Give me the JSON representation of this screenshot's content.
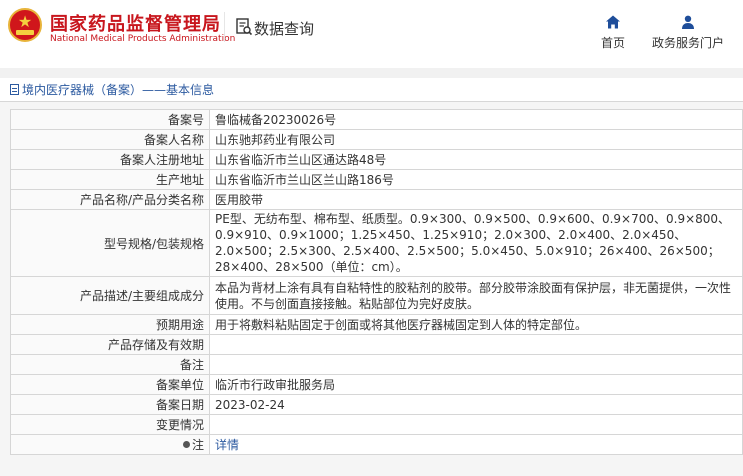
{
  "header": {
    "logo_cn": "国家药品监督管理局",
    "logo_en": "National Medical Products Administration",
    "query_title": "数据查询",
    "nav": [
      {
        "label": "首页",
        "icon": "home-icon"
      },
      {
        "label": "政务服务门户",
        "icon": "user-icon"
      }
    ]
  },
  "breadcrumb": "境内医疗器械（备案）——基本信息",
  "details_link": "详情",
  "rows": [
    {
      "key": "备案号",
      "value": "鲁临械备20230026号"
    },
    {
      "key": "备案人名称",
      "value": "山东驰邦药业有限公司"
    },
    {
      "key": "备案人注册地址",
      "value": "山东省临沂市兰山区通达路48号"
    },
    {
      "key": "生产地址",
      "value": "山东省临沂市兰山区兰山路186号"
    },
    {
      "key": "产品名称/产品分类名称",
      "value": "医用胶带"
    },
    {
      "key": "型号规格/包装规格",
      "value": "PE型、无纺布型、棉布型、纸质型。0.9×300、0.9×500、0.9×600、0.9×700、0.9×800、0.9×910、0.9×1000；1.25×450、1.25×910；2.0×300、2.0×400、2.0×450、2.0×500；2.5×300、2.5×400、2.5×500；5.0×450、5.0×910；26×400、26×500；28×400、28×500（单位：cm）。"
    },
    {
      "key": "产品描述/主要组成成分",
      "value": "本品为背材上涂有具有自粘特性的胶粘剂的胶带。部分胶带涂胶面有保护层，非无菌提供，一次性使用。不与创面直接接触。粘贴部位为完好皮肤。"
    },
    {
      "key": "预期用途",
      "value": "用于将敷料粘贴固定于创面或将其他医疗器械固定到人体的特定部位。"
    },
    {
      "key": "产品存储及有效期",
      "value": ""
    },
    {
      "key": "备注",
      "value": ""
    },
    {
      "key": "备案单位",
      "value": "临沂市行政审批服务局"
    },
    {
      "key": "备案日期",
      "value": "2023-02-24"
    },
    {
      "key": "变更情况",
      "value": ""
    },
    {
      "key": "注",
      "value": ""
    }
  ],
  "colors": {
    "brand_red": "#c8161d",
    "link_blue": "#2c5aa0",
    "border": "#d6d6d6"
  }
}
